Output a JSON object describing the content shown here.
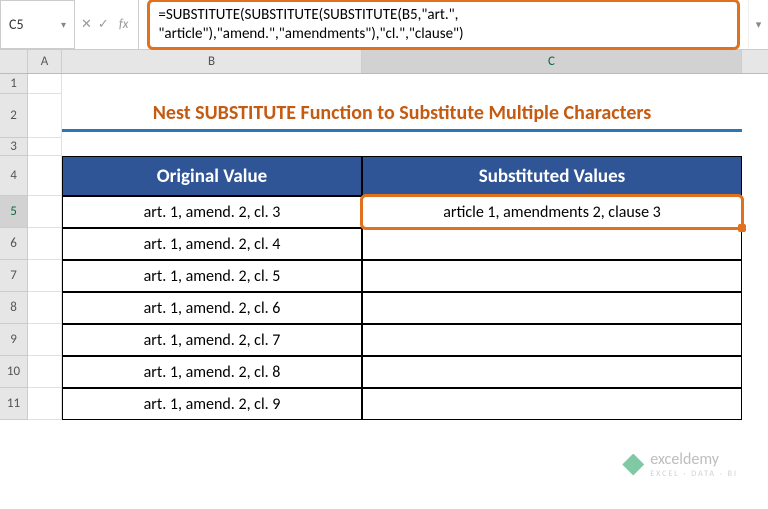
{
  "nameBox": "C5",
  "formula": "=SUBSTITUTE(SUBSTITUTE(SUBSTITUTE(B5,\"art.\", \"article\"),\"amend.\",\"amendments\"),\"cl.\",\"clause\")",
  "columns": {
    "a": "A",
    "b": "B",
    "c": "C"
  },
  "rowNums": [
    "1",
    "2",
    "3",
    "4",
    "5",
    "6",
    "7",
    "8",
    "9",
    "10",
    "11"
  ],
  "title": "Nest SUBSTITUTE Function to Substitute Multiple Characters",
  "headers": {
    "b": "Original Value",
    "c": "Substituted Values"
  },
  "rows": [
    {
      "b": "art. 1, amend. 2, cl. 3",
      "c": "article 1, amendments 2, clause 3"
    },
    {
      "b": "art. 1, amend. 2, cl. 4",
      "c": ""
    },
    {
      "b": "art. 1, amend. 2, cl. 5",
      "c": ""
    },
    {
      "b": "art. 1, amend. 2, cl. 6",
      "c": ""
    },
    {
      "b": "art. 1, amend. 2, cl. 7",
      "c": ""
    },
    {
      "b": "art. 1, amend. 2, cl. 8",
      "c": ""
    },
    {
      "b": "art. 1, amend. 2, cl. 9",
      "c": ""
    }
  ],
  "watermark": {
    "name": "exceldemy",
    "tagline": "EXCEL · DATA · BI"
  },
  "chart_data": {
    "type": "table",
    "title": "Nest SUBSTITUTE Function to Substitute Multiple Characters",
    "columns": [
      "Original Value",
      "Substituted Values"
    ],
    "rows": [
      [
        "art. 1, amend. 2, cl. 3",
        "article 1, amendments 2, clause 3"
      ],
      [
        "art. 1, amend. 2, cl. 4",
        ""
      ],
      [
        "art. 1, amend. 2, cl. 5",
        ""
      ],
      [
        "art. 1, amend. 2, cl. 6",
        ""
      ],
      [
        "art. 1, amend. 2, cl. 7",
        ""
      ],
      [
        "art. 1, amend. 2, cl. 8",
        ""
      ],
      [
        "art. 1, amend. 2, cl. 9",
        ""
      ]
    ]
  }
}
